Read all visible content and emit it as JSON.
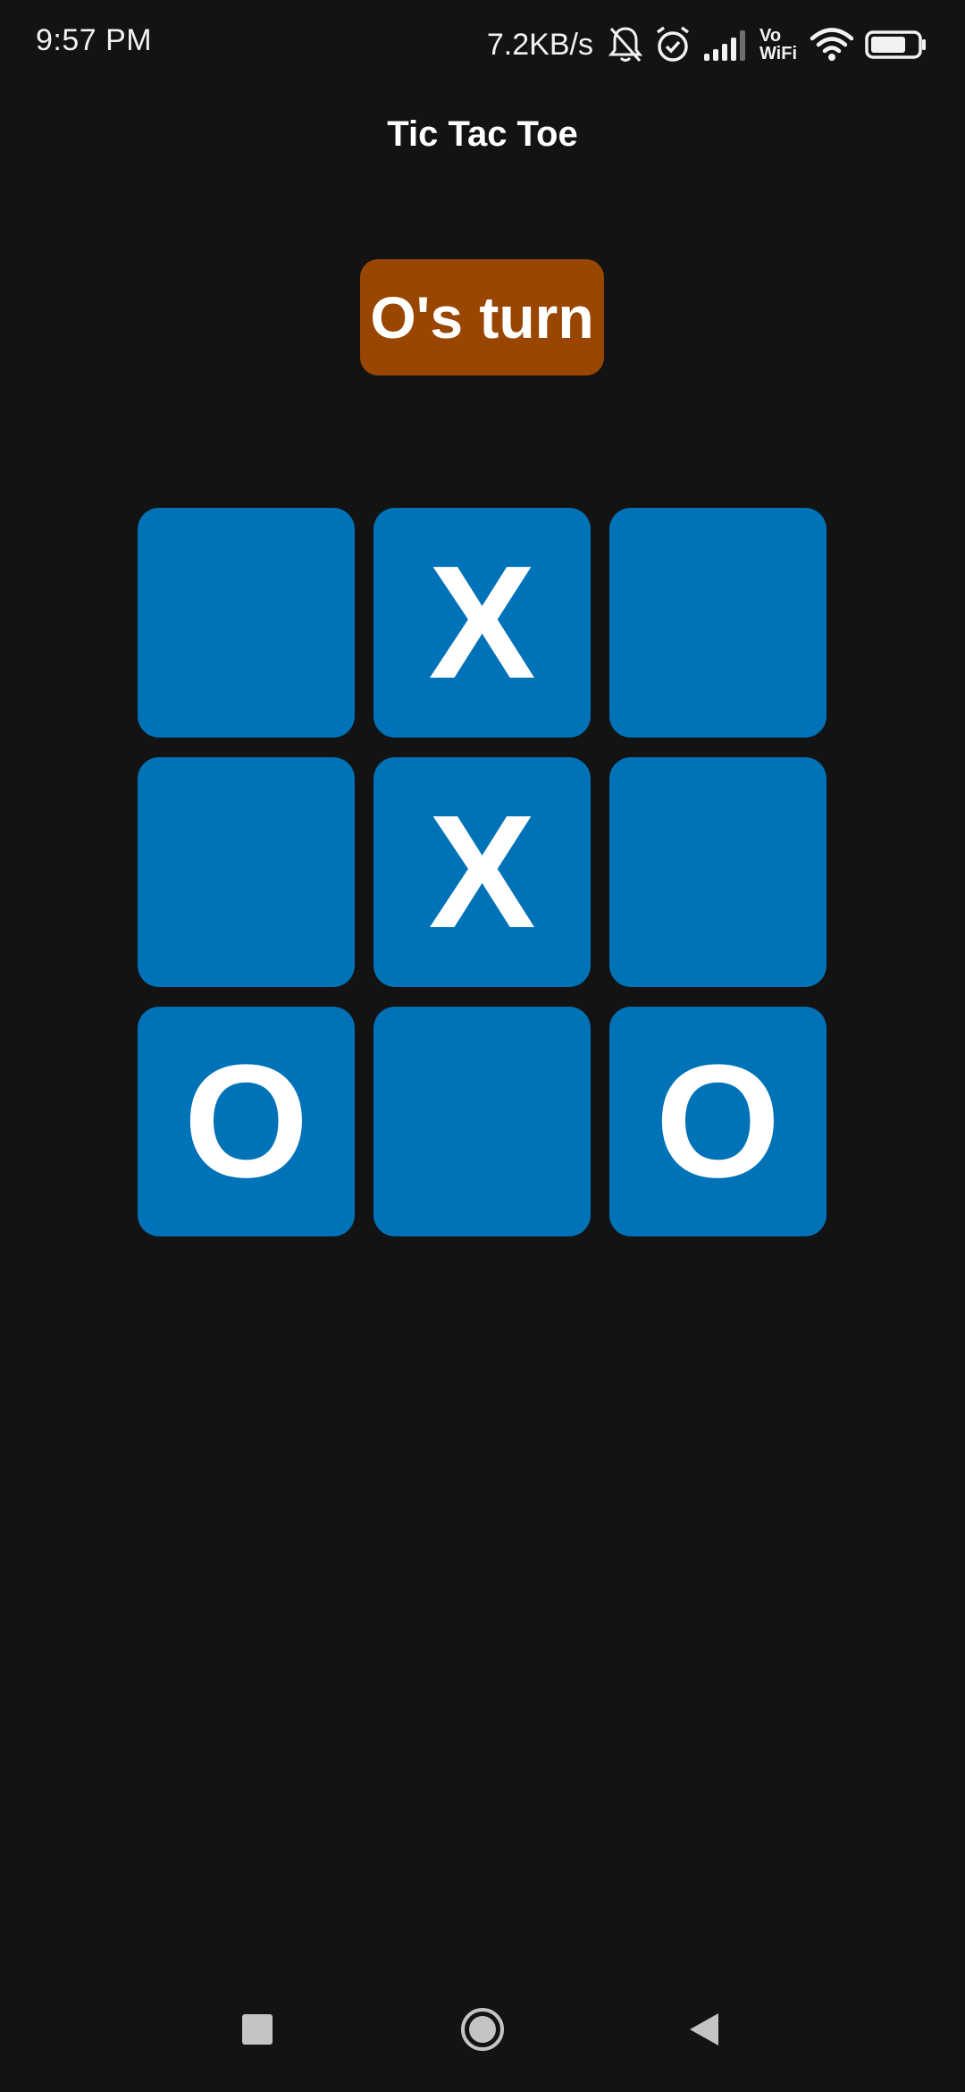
{
  "status_bar": {
    "time": "9:57 PM",
    "net_speed": "7.2KB/s",
    "vowifi_top": "Vo",
    "vowifi_bottom": "WiFi",
    "icons": [
      "bell-off-icon",
      "alarm-icon",
      "signal-icon",
      "wifi-icon",
      "battery-icon"
    ],
    "battery_level": 0.75
  },
  "app": {
    "title": "Tic Tac Toe"
  },
  "game": {
    "turn_label": "O's turn",
    "board": [
      "",
      "X",
      "",
      "",
      "X",
      "",
      "O",
      "",
      "O"
    ]
  },
  "colors": {
    "background": "#131313",
    "cell": "#0072b8",
    "turn_badge": "#984601",
    "text": "#ffffff"
  },
  "nav_bar": {
    "icons": [
      "recents-icon",
      "home-icon",
      "back-icon"
    ]
  }
}
